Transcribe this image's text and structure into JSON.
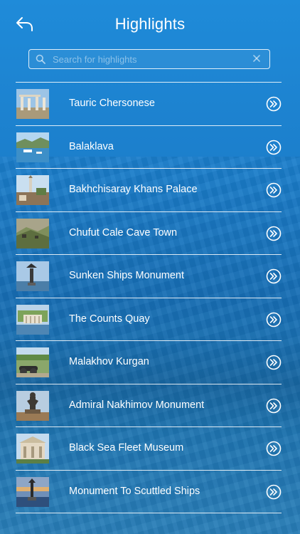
{
  "header": {
    "title": "Highlights",
    "back_icon": "back-arrow-icon"
  },
  "search": {
    "placeholder": "Search for highlights",
    "value": ""
  },
  "highlights": [
    {
      "label": "Tauric Chersonese",
      "thumb": "ancient-columns"
    },
    {
      "label": "Balaklava",
      "thumb": "harbor-boats"
    },
    {
      "label": "Bakhchisaray Khans Palace",
      "thumb": "palace-minaret"
    },
    {
      "label": "Chufut Cale Cave Town",
      "thumb": "cave-rocks"
    },
    {
      "label": "Sunken Ships Monument",
      "thumb": "sea-monument"
    },
    {
      "label": "The Counts Quay",
      "thumb": "quay-colonnade"
    },
    {
      "label": "Malakhov Kurgan",
      "thumb": "cannon-park"
    },
    {
      "label": "Admiral Nakhimov Monument",
      "thumb": "statue"
    },
    {
      "label": "Black Sea Fleet Museum",
      "thumb": "museum-facade"
    },
    {
      "label": "Monument To Scuttled Ships",
      "thumb": "column-sunset"
    }
  ],
  "colors": {
    "background_top": "#1f8bd9",
    "background_bottom": "#2a7fb8",
    "foreground": "#ffffff"
  }
}
